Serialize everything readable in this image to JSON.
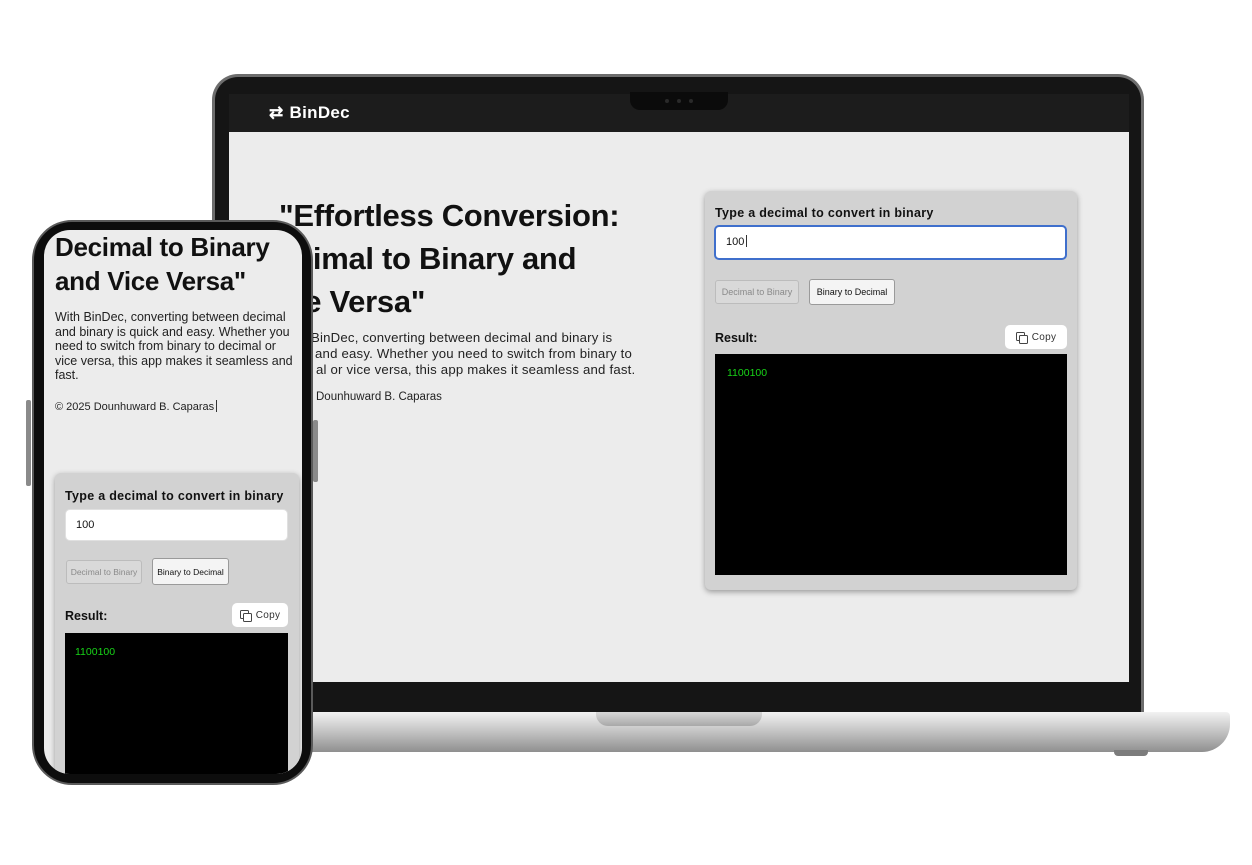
{
  "app": {
    "brand": "BinDec",
    "brand_icon": "swap-arrows-icon"
  },
  "hero": {
    "title_laptop": "\"Effortless Conversion: ecimal to Binary and ice Versa\"",
    "title_laptop_lines": [
      "\"Effortless Conversion:",
      "ecimal to Binary and",
      "ice Versa\""
    ],
    "description_laptop_lines": [
      "BinDec, converting between decimal and binary is",
      "and easy. Whether you need to switch from binary to",
      "al or vice versa, this app makes it seamless and fast."
    ],
    "footer_laptop": "Dounhuward B. Caparas",
    "title_phone_lines": [
      "Decimal to Binary",
      "and Vice Versa\""
    ],
    "description_phone": "With BinDec, converting between decimal and binary is quick and easy. Whether you need to switch from binary to decimal or vice versa, this app makes it seamless and fast.",
    "footer_phone": "© 2025 Dounhuward B. Caparas"
  },
  "converter": {
    "label": "Type a decimal to convert in binary",
    "input_value": "100",
    "mode_buttons": [
      {
        "label": "Decimal to Binary",
        "state": "disabled"
      },
      {
        "label": "Binary to Decimal",
        "state": "active"
      }
    ],
    "result_label": "Result:",
    "copy_label": "Copy",
    "result_value": "1100100"
  },
  "colors": {
    "topbar": "#1c1c1c",
    "page_bg": "#ececec",
    "card_bg": "#d2d2d2",
    "input_focus_border": "#3f6fcc",
    "result_bg": "#000000",
    "result_text": "#18d418"
  }
}
